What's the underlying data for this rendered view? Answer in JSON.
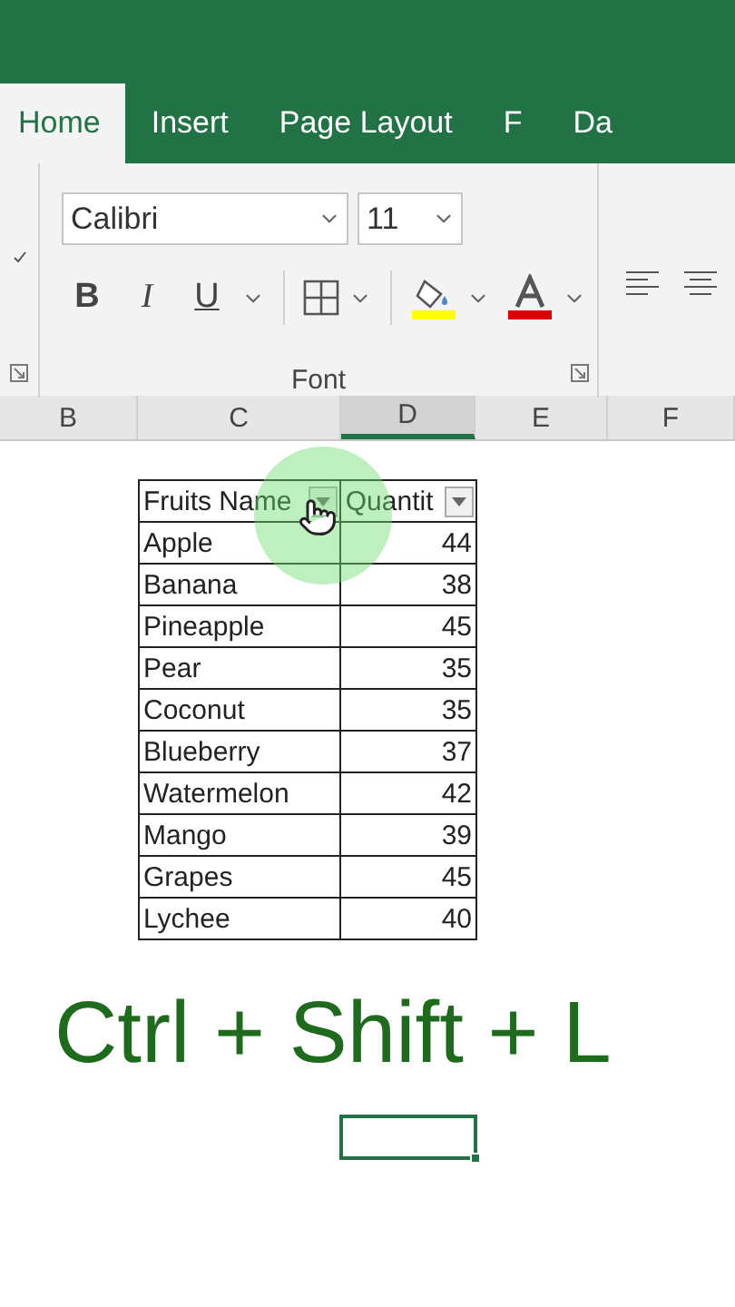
{
  "ribbon": {
    "tabs": [
      {
        "label": "Home",
        "selected": true
      },
      {
        "label": "Insert",
        "selected": false
      },
      {
        "label": "Page Layout",
        "selected": false
      },
      {
        "label": "F",
        "selected": false
      },
      {
        "label": "Da",
        "selected": false
      }
    ],
    "font_name": "Calibri",
    "font_size": "11",
    "group_label": "Font",
    "format_buttons": [
      "B",
      "I",
      "U"
    ]
  },
  "column_headers": [
    {
      "label": "B",
      "selected": false
    },
    {
      "label": "C",
      "selected": false
    },
    {
      "label": "D",
      "selected": true
    },
    {
      "label": "E",
      "selected": false
    },
    {
      "label": "F",
      "selected": false
    }
  ],
  "table": {
    "columns": [
      "Fruits Name",
      "Quantit"
    ],
    "rows": [
      [
        "Apple",
        "44"
      ],
      [
        "Banana",
        "38"
      ],
      [
        "Pineapple",
        "45"
      ],
      [
        "Pear",
        "35"
      ],
      [
        "Coconut",
        "35"
      ],
      [
        "Blueberry",
        "37"
      ],
      [
        "Watermelon",
        "42"
      ],
      [
        "Mango",
        "39"
      ],
      [
        "Grapes",
        "45"
      ],
      [
        "Lychee",
        "40"
      ]
    ]
  },
  "caption": "Ctrl + Shift + L"
}
